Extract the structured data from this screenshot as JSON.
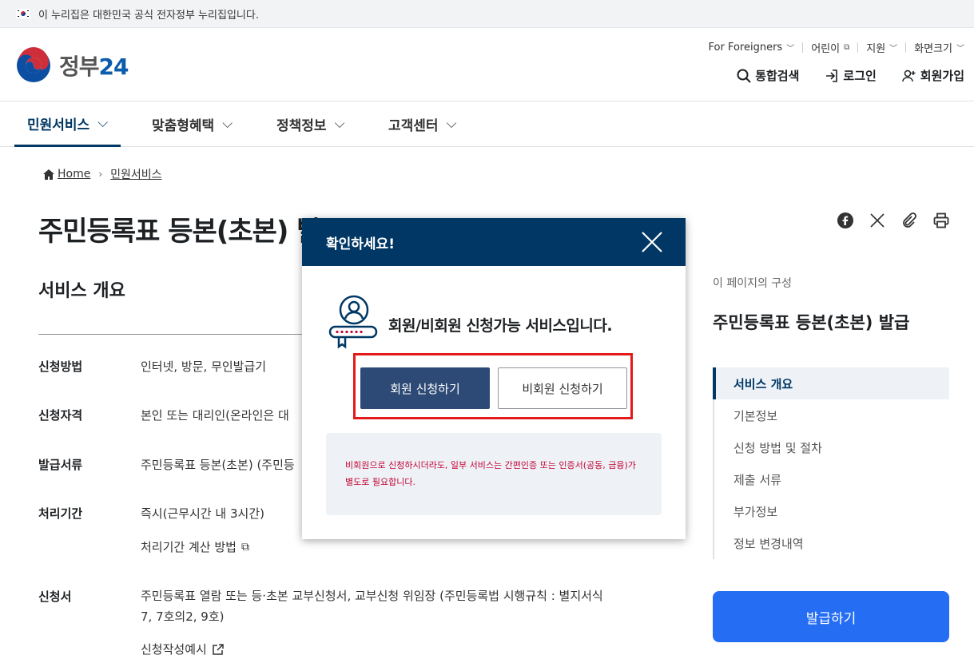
{
  "gov_banner": {
    "text": "이 누리집은 대한민국 공식 전자정부 누리집입니다."
  },
  "logo": {
    "text": "정부",
    "num": "24"
  },
  "util_menu": [
    {
      "label": "For Foreigners",
      "icon": "chevron-down-icon"
    },
    {
      "label": "어린이",
      "icon": "external-link-icon"
    },
    {
      "label": "지원",
      "icon": "chevron-down-icon"
    },
    {
      "label": "화면크기",
      "icon": "chevron-down-icon"
    }
  ],
  "header_actions": {
    "search": "통합검색",
    "login": "로그인",
    "signup": "회원가입"
  },
  "gnb": [
    {
      "label": "민원서비스",
      "active": true
    },
    {
      "label": "맞춤형혜택"
    },
    {
      "label": "정책정보"
    },
    {
      "label": "고객센터"
    }
  ],
  "breadcrumb": {
    "home": "Home",
    "current": "민원서비스"
  },
  "page_title": "주민등록표 등본(초본) 발급",
  "section_title": "서비스 개요",
  "info": [
    {
      "label": "신청방법",
      "value": "인터넷, 방문, 무인발급기"
    },
    {
      "label": "신청자격",
      "value": "본인 또는 대리인(온라인은 대"
    },
    {
      "label": "발급서류",
      "value": "주민등록표 등본(초본) (주민등"
    },
    {
      "label": "처리기간",
      "value": "즉시(근무시간 내 3시간)",
      "link": "처리기간 계산 방법"
    },
    {
      "label": "신청서",
      "value1": "주민등록표 열람 또는 등·초본 교부신청서, 교부신청 위임장 (주민등록법 시행규칙 : 별지서식",
      "value2": "7, 7호의2, 9호)",
      "link": "신청작성예시"
    }
  ],
  "toc": {
    "heading": "이 페이지의 구성",
    "title": "주민등록표 등본(초본) 발급",
    "items": [
      "서비스 개요",
      "기본정보",
      "신청 방법 및 절차",
      "제출 서류",
      "부가정보",
      "정보 변경내역"
    ]
  },
  "issue_button": "발급하기",
  "modal": {
    "title": "확인하세요!",
    "message": "회원/비회원 신청가능 서비스입니다.",
    "member_button": "회원 신청하기",
    "guest_button": "비회원 신청하기",
    "notice": "비회원으로 신청하시더라도, 일부 서비스는 간편인증 또는 인증서(공동, 금융)가 별도로 필요합니다."
  },
  "colors": {
    "primary_navy": "#003764",
    "accent_blue": "#256ef4",
    "notice_red": "#c30534",
    "highlight_red": "#e31a1a"
  }
}
